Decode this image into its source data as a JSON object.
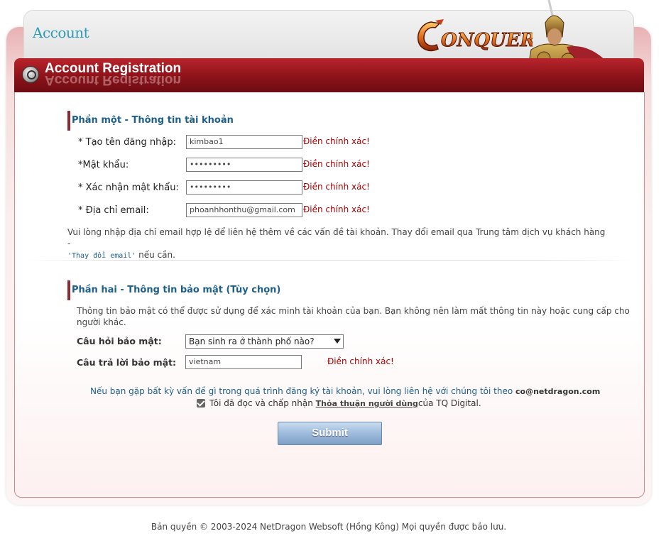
{
  "header": {
    "title": "Account",
    "logo_text": "CONQUER",
    "banner_title": "Account Registration"
  },
  "section1": {
    "heading": "Phần một - Thông tin tài khoản",
    "fields": [
      {
        "label": "* Tạo tên đăng nhập:",
        "value": "kimbao1",
        "error": "Điền chính xác!"
      },
      {
        "label": "*Mật khẩu:",
        "value": "•••••••••",
        "error": "Điền chính xác!"
      },
      {
        "label": "* Xác nhận mật khẩu:",
        "value": "•••••••••",
        "error": "Điền chính xác!"
      },
      {
        "label": "* Địa chỉ email:",
        "value": "phoanhhonthu@gmail.com",
        "error": "Điền chính xác!"
      }
    ],
    "note": "Vui lòng nhập địa chỉ email hợp lệ để liên hệ thêm về các vấn đề tài khoản. Thay đổi email qua Trung tâm dịch vụ khách hàng -",
    "change_email_link": "'Thay đổi email'",
    "note_suffix": "nếu cần."
  },
  "section2": {
    "heading": "Phần hai - Thông tin bảo mật (Tùy chọn)",
    "description": "Thông tin bảo mật có thể được sử dụng để xác minh tài khoản của bạn. Bạn không nên làm mất thông tin này hoặc cung cấp cho người khác.",
    "question_label": "Câu hỏi bảo mật:",
    "question_value": "Bạn sinh ra ở thành phố nào?",
    "answer_label": "Câu trả lời bảo mật:",
    "answer_value": "vietnam",
    "answer_error": "Điền chính xác!"
  },
  "contact": {
    "text": "Nếu bạn gặp bất kỳ vấn đề gì trong quá trình đăng ký tài khoản, vui lòng liên hệ với chúng tôi theo",
    "email": "co@netdragon.com"
  },
  "agreement": {
    "prefix": "Tôi đã đọc và chấp nhận",
    "terms": "Thỏa thuận người dùng",
    "suffix": "của TQ Digital.",
    "checked": true
  },
  "submit_label": "Submit",
  "footer": "Bản quyền © 2003-2024 NetDragon Websoft (Hồng Kông) Mọi quyền được bảo lưu.",
  "colors": {
    "banner": "#8c1219",
    "heading": "#1d5f8a",
    "error": "#aa0000",
    "account_title": "#2b9bb8"
  }
}
